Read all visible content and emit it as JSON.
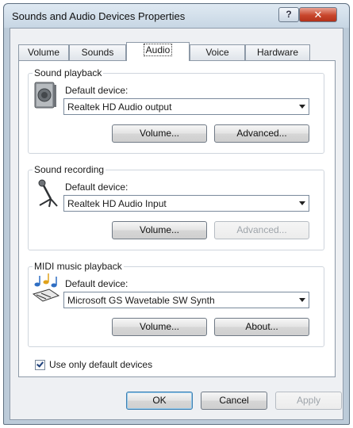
{
  "window": {
    "title": "Sounds and Audio Devices Properties",
    "help": "?",
    "close": "✕"
  },
  "tabs": [
    {
      "label": "Volume",
      "active": false
    },
    {
      "label": "Sounds",
      "active": false
    },
    {
      "label": "Audio",
      "active": true
    },
    {
      "label": "Voice",
      "active": false
    },
    {
      "label": "Hardware",
      "active": false
    }
  ],
  "sound_playback": {
    "title": "Sound playback",
    "icon": "speaker-icon",
    "label": "Default device:",
    "value": "Realtek HD Audio output",
    "volume_button": "Volume...",
    "advanced_button": "Advanced...",
    "advanced_enabled": true
  },
  "sound_recording": {
    "title": "Sound recording",
    "icon": "microphone-icon",
    "label": "Default device:",
    "value": "Realtek HD Audio Input",
    "volume_button": "Volume...",
    "advanced_button": "Advanced...",
    "advanced_enabled": false
  },
  "midi_playback": {
    "title": "MIDI music playback",
    "icon": "music-notes-icon",
    "label": "Default device:",
    "value": "Microsoft GS Wavetable SW Synth",
    "volume_button": "Volume...",
    "about_button": "About..."
  },
  "use_default_devices": {
    "label": "Use only default devices",
    "checked": true
  },
  "footer": {
    "ok": "OK",
    "cancel": "Cancel",
    "apply": "Apply",
    "apply_enabled": false
  },
  "colors": {
    "close_red": "#c8462c",
    "frame_blue": "#c7d6e4",
    "focus_blue": "#3c7fb1"
  }
}
